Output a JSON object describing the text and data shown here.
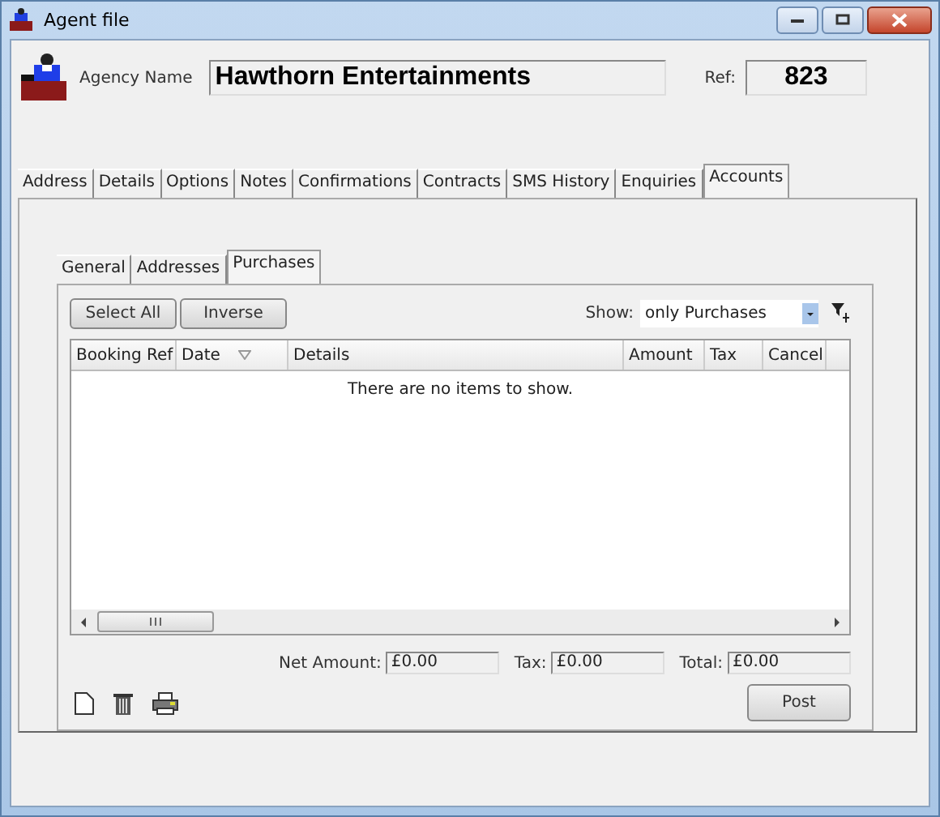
{
  "window": {
    "title": "Agent file"
  },
  "header": {
    "agency_name_label": "Agency Name",
    "agency_name": "Hawthorn Entertainments",
    "ref_label": "Ref:",
    "ref": "823"
  },
  "tabs": [
    {
      "label": "Address",
      "selected": false
    },
    {
      "label": "Details",
      "selected": false
    },
    {
      "label": "Options",
      "selected": false
    },
    {
      "label": "Notes",
      "selected": false
    },
    {
      "label": "Confirmations",
      "selected": false
    },
    {
      "label": "Contracts",
      "selected": false
    },
    {
      "label": "SMS History",
      "selected": false
    },
    {
      "label": "Enquiries",
      "selected": false
    },
    {
      "label": "Accounts",
      "selected": true
    }
  ],
  "subtabs": [
    {
      "label": "General",
      "selected": false
    },
    {
      "label": "Addresses",
      "selected": false
    },
    {
      "label": "Purchases",
      "selected": true
    }
  ],
  "toolbar": {
    "buttons": [
      "Select All",
      "Inverse"
    ],
    "show_label": "Show:",
    "show_value": "only Purchases"
  },
  "table": {
    "columns": [
      {
        "label": "Booking Ref",
        "sorted": false
      },
      {
        "label": "Date",
        "sorted": true
      },
      {
        "label": "Details",
        "sorted": false
      },
      {
        "label": "Amount",
        "sorted": false
      },
      {
        "label": "Tax",
        "sorted": false
      },
      {
        "label": "Cancel",
        "sorted": false
      }
    ],
    "empty_message": "There are no items to show."
  },
  "totals": [
    {
      "label": "Net Amount:",
      "value": "£0.00"
    },
    {
      "label": "Tax:",
      "value": "£0.00"
    },
    {
      "label": "Total:",
      "value": "£0.00"
    }
  ],
  "post_button": "Post"
}
